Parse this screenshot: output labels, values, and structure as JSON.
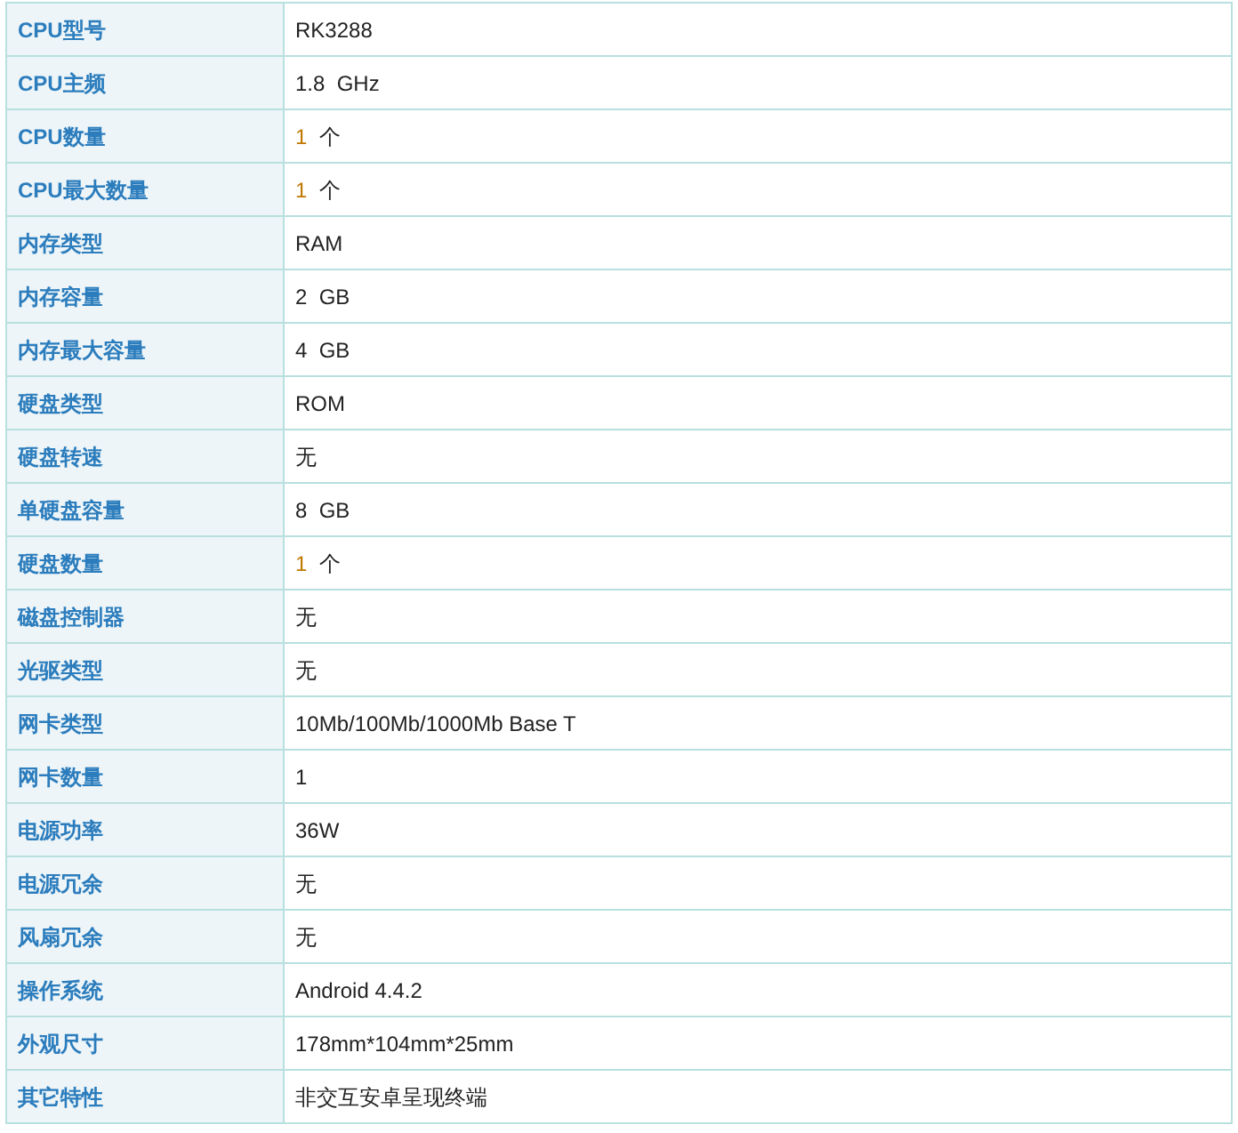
{
  "rows": [
    {
      "label": "CPU型号",
      "value": "RK3288"
    },
    {
      "label": "CPU主频",
      "value": "1.8  GHz"
    },
    {
      "label": "CPU数量",
      "kind": "count",
      "number": "1",
      "unit": "个"
    },
    {
      "label": "CPU最大数量",
      "kind": "count",
      "number": "1",
      "unit": "个"
    },
    {
      "label": "内存类型",
      "value": "RAM"
    },
    {
      "label": "内存容量",
      "value": "2  GB"
    },
    {
      "label": "内存最大容量",
      "value": "4  GB"
    },
    {
      "label": "硬盘类型",
      "value": "ROM"
    },
    {
      "label": "硬盘转速",
      "value": "无"
    },
    {
      "label": "单硬盘容量",
      "value": "8  GB"
    },
    {
      "label": "硬盘数量",
      "kind": "count",
      "number": "1",
      "unit": "个"
    },
    {
      "label": "磁盘控制器",
      "value": "无"
    },
    {
      "label": "光驱类型",
      "value": "无"
    },
    {
      "label": "网卡类型",
      "value": "10Mb/100Mb/1000Mb Base T"
    },
    {
      "label": "网卡数量",
      "value": "1"
    },
    {
      "label": "电源功率",
      "value": "36W"
    },
    {
      "label": "电源冗余",
      "value": "无"
    },
    {
      "label": "风扇冗余",
      "value": "无"
    },
    {
      "label": "操作系统",
      "value": "Android 4.4.2"
    },
    {
      "label": "外观尺寸",
      "value": "178mm*104mm*25mm"
    },
    {
      "label": "其它特性",
      "value": "非交互安卓呈现终端"
    }
  ]
}
